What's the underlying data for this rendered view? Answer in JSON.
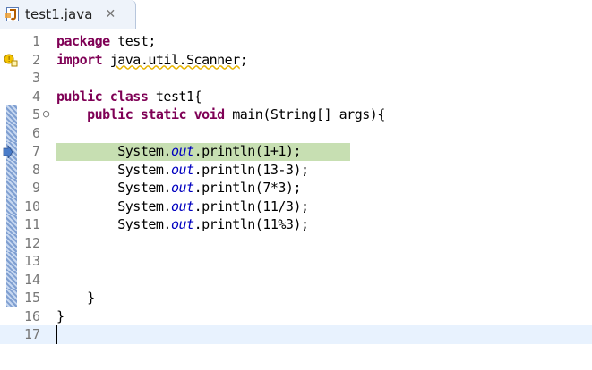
{
  "tab": {
    "title": "test1.java",
    "close_glyph": "✕",
    "icon": "java-file-icon"
  },
  "lines": [
    {
      "num": "1",
      "tokens": [
        {
          "t": "package",
          "c": "kw"
        },
        {
          "t": " test;"
        }
      ]
    },
    {
      "num": "2",
      "tokens": [
        {
          "t": "import",
          "c": "kw"
        },
        {
          "t": " "
        },
        {
          "t": "java.util.Scanner",
          "c": "squiggle"
        },
        {
          "t": ";"
        }
      ],
      "marker": "warning"
    },
    {
      "num": "3",
      "tokens": []
    },
    {
      "num": "4",
      "tokens": [
        {
          "t": "public",
          "c": "kw"
        },
        {
          "t": " "
        },
        {
          "t": "class",
          "c": "kw"
        },
        {
          "t": " test1{"
        }
      ]
    },
    {
      "num": "5",
      "tokens": [
        {
          "t": "    "
        },
        {
          "t": "public",
          "c": "kw"
        },
        {
          "t": " "
        },
        {
          "t": "static",
          "c": "kw"
        },
        {
          "t": " "
        },
        {
          "t": "void",
          "c": "kw"
        },
        {
          "t": " main(String[] args){"
        }
      ],
      "fold": "⊖",
      "gutter": true
    },
    {
      "num": "6",
      "tokens": [],
      "gutter": true
    },
    {
      "num": "7",
      "tokens": [
        {
          "t": "        System."
        },
        {
          "t": "out",
          "c": "fld"
        },
        {
          "t": ".println(1+1);"
        }
      ],
      "highlight": true,
      "marker": "debug",
      "gutter": true
    },
    {
      "num": "8",
      "tokens": [
        {
          "t": "        System."
        },
        {
          "t": "out",
          "c": "fld"
        },
        {
          "t": ".println(13-3);"
        }
      ],
      "gutter": true
    },
    {
      "num": "9",
      "tokens": [
        {
          "t": "        System."
        },
        {
          "t": "out",
          "c": "fld"
        },
        {
          "t": ".println(7*3);"
        }
      ],
      "gutter": true
    },
    {
      "num": "10",
      "tokens": [
        {
          "t": "        System."
        },
        {
          "t": "out",
          "c": "fld"
        },
        {
          "t": ".println(11/3);"
        }
      ],
      "gutter": true
    },
    {
      "num": "11",
      "tokens": [
        {
          "t": "        System."
        },
        {
          "t": "out",
          "c": "fld"
        },
        {
          "t": ".println(11%3);"
        }
      ],
      "gutter": true
    },
    {
      "num": "12",
      "tokens": [],
      "gutter": true
    },
    {
      "num": "13",
      "tokens": [],
      "gutter": true
    },
    {
      "num": "14",
      "tokens": [],
      "gutter": true
    },
    {
      "num": "15",
      "tokens": [
        {
          "t": "    }"
        }
      ],
      "gutter": true
    },
    {
      "num": "16",
      "tokens": [
        {
          "t": "}"
        }
      ]
    },
    {
      "num": "17",
      "tokens": [],
      "current": true,
      "caret": true
    }
  ],
  "colors": {
    "keyword": "#7f0055",
    "field": "#0000c0",
    "line_number": "#787878",
    "highlight": "#c7dfb2",
    "current_line": "#e8f2fe"
  }
}
